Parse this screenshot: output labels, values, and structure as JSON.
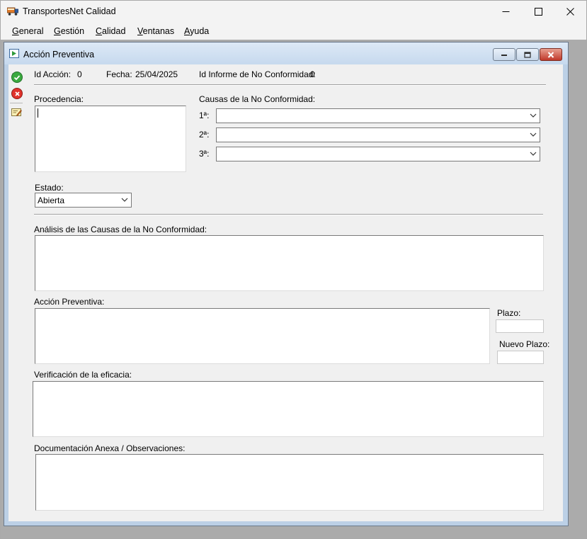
{
  "window": {
    "title": "TransportesNet Calidad"
  },
  "menu": [
    {
      "label": "General",
      "accel": "G",
      "rest": "eneral"
    },
    {
      "label": "Gestión",
      "accel": "G",
      "rest": "estión"
    },
    {
      "label": "Calidad",
      "accel": "C",
      "rest": "alidad"
    },
    {
      "label": "Ventanas",
      "accel": "V",
      "rest": "entanas"
    },
    {
      "label": "Ayuda",
      "accel": "A",
      "rest": "yuda"
    }
  ],
  "child": {
    "title": "Acción Preventiva"
  },
  "header": {
    "id_accion_label": "Id Acción:",
    "id_accion_value": "0",
    "fecha_label": "Fecha:",
    "fecha_value": "25/04/2025",
    "informe_label": "Id Informe de No Conformidad:",
    "informe_value": "0"
  },
  "form": {
    "procedencia_label": "Procedencia:",
    "procedencia_value": "",
    "causas_label": "Causas de la No Conformidad:",
    "causas": [
      {
        "label": "1ª:",
        "value": ""
      },
      {
        "label": "2ª:",
        "value": ""
      },
      {
        "label": "3ª:",
        "value": ""
      }
    ],
    "estado_label": "Estado:",
    "estado_value": "Abierta",
    "analisis_label": "Análisis de las Causas de la No Conformidad:",
    "accion_label": "Acción Preventiva:",
    "plazo_label": "Plazo:",
    "nuevo_plazo_label": "Nuevo Plazo:",
    "verificacion_label": "Verificación de la eficacia:",
    "documentacion_label": "Documentación Anexa / Observaciones:"
  },
  "icons": {
    "toolbar": [
      "save-icon",
      "cancel-icon",
      "edit-icon"
    ]
  }
}
